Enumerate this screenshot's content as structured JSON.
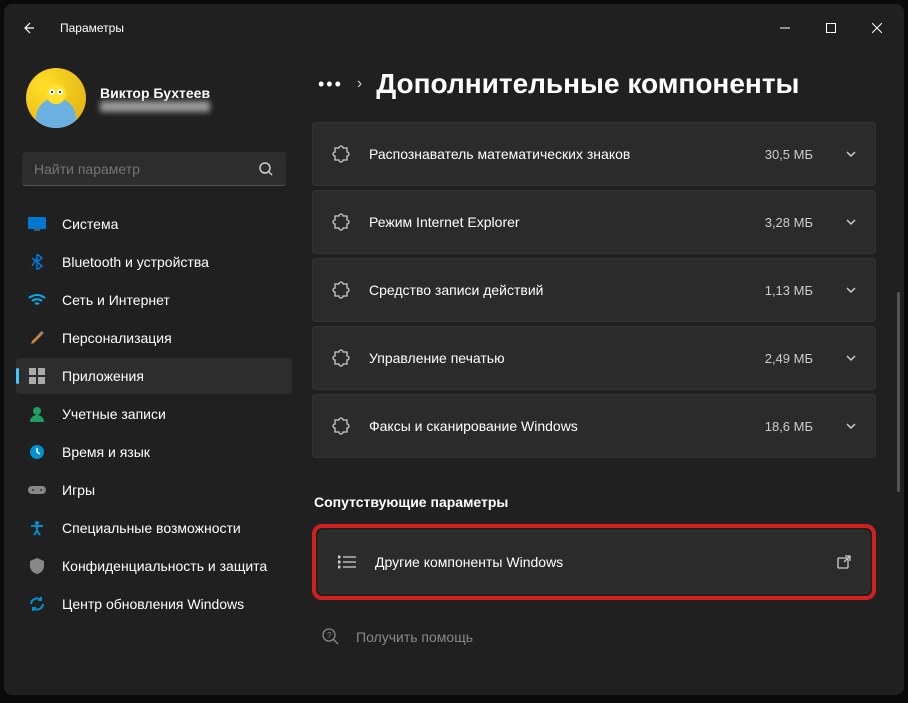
{
  "window": {
    "title": "Параметры"
  },
  "profile": {
    "name": "Виктор Бухтеев",
    "email": "user@example.com"
  },
  "search": {
    "placeholder": "Найти параметр"
  },
  "nav": {
    "items": [
      {
        "label": "Система",
        "icon": "system",
        "color": "#0078d4"
      },
      {
        "label": "Bluetooth и устройства",
        "icon": "bluetooth",
        "color": "#0078d4"
      },
      {
        "label": "Сеть и Интернет",
        "icon": "wifi",
        "color": "#00b0f0"
      },
      {
        "label": "Персонализация",
        "icon": "brush",
        "color": "#c08030"
      },
      {
        "label": "Приложения",
        "icon": "apps",
        "color": "#888",
        "active": true
      },
      {
        "label": "Учетные записи",
        "icon": "account",
        "color": "#20a060"
      },
      {
        "label": "Время и язык",
        "icon": "time",
        "color": "#0090d0"
      },
      {
        "label": "Игры",
        "icon": "games",
        "color": "#888"
      },
      {
        "label": "Специальные возможности",
        "icon": "accessibility",
        "color": "#0090d0"
      },
      {
        "label": "Конфиденциальность и защита",
        "icon": "privacy",
        "color": "#888"
      },
      {
        "label": "Центр обновления Windows",
        "icon": "update",
        "color": "#0090d0"
      }
    ]
  },
  "page": {
    "title": "Дополнительные компоненты",
    "components": [
      {
        "label": "Распознаватель математических знаков",
        "size": "30,5 МБ"
      },
      {
        "label": "Режим Internet Explorer",
        "size": "3,28 МБ"
      },
      {
        "label": "Средство записи действий",
        "size": "1,13 МБ"
      },
      {
        "label": "Управление печатью",
        "size": "2,49 МБ"
      },
      {
        "label": "Факсы и сканирование Windows",
        "size": "18,6 МБ"
      }
    ],
    "related": {
      "title": "Сопутствующие параметры",
      "item": "Другие компоненты Windows"
    },
    "help": "Получить помощь"
  }
}
